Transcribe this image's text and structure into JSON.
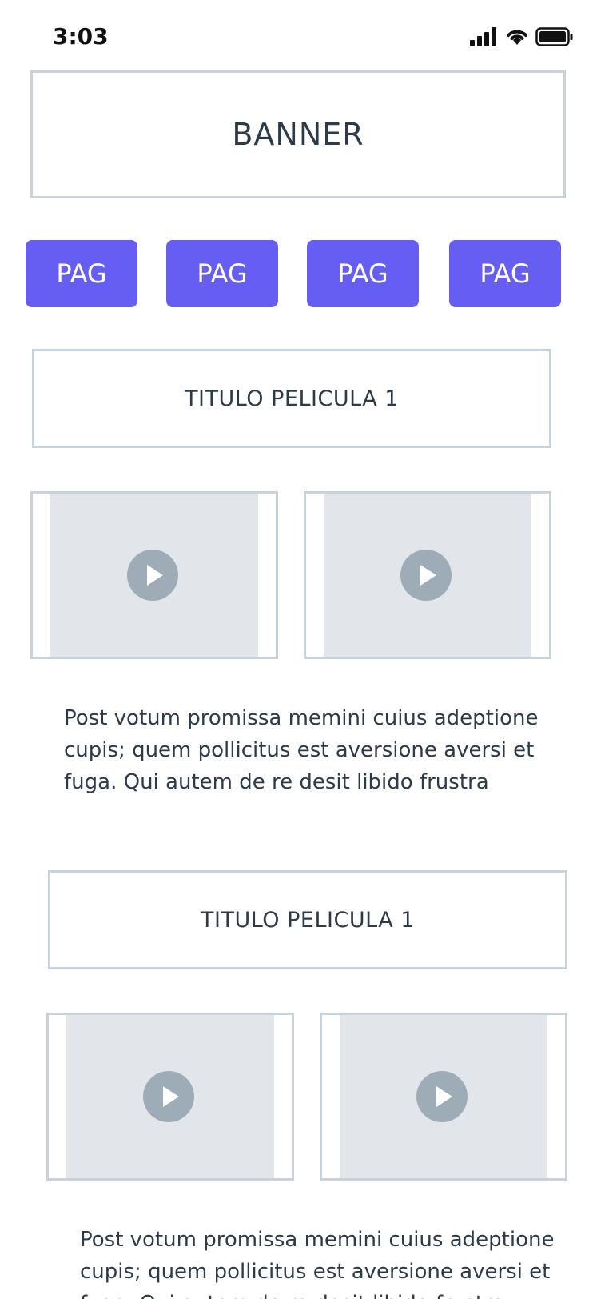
{
  "status_bar": {
    "time": "3:03",
    "icons": [
      "signal-icon",
      "wifi-icon",
      "battery-icon"
    ]
  },
  "banner": {
    "label": "BANNER"
  },
  "pagination": [
    {
      "label": "PAG"
    },
    {
      "label": "PAG"
    },
    {
      "label": "PAG"
    },
    {
      "label": "PAG"
    }
  ],
  "movies": [
    {
      "title": "TITULO PELICULA 1",
      "videos": [
        {
          "icon": "play-icon"
        },
        {
          "icon": "play-icon"
        }
      ],
      "description": "Post votum promissa memini cuius adeptione cupis; quem pollicitus est aversione aversi et fuga. Qui autem de re desit libido frustra"
    },
    {
      "title": "TITULO PELICULA 1",
      "videos": [
        {
          "icon": "play-icon"
        },
        {
          "icon": "play-icon"
        }
      ],
      "description": "Post votum promissa memini cuius adeptione cupis; quem pollicitus est aversione aversi et fuga. Qui autem de re desit libido frustra"
    }
  ],
  "colors": {
    "accent": "#665ef2",
    "border": "#c7d2dc",
    "thumb": "#e2e6ea",
    "play": "#9eacb8",
    "text": "#2d3a48"
  }
}
